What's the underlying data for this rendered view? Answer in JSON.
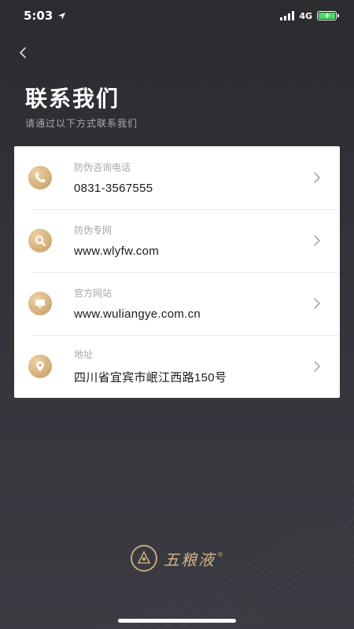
{
  "status_bar": {
    "time": "5:03",
    "network": "4G"
  },
  "header": {
    "title": "联系我们",
    "subtitle": "请通过以下方式联系我们"
  },
  "contacts": [
    {
      "label": "防伪咨询电话",
      "value": "0831-3567555",
      "icon": "phone-icon"
    },
    {
      "label": "防伪专网",
      "value": "www.wlyfw.com",
      "icon": "search-icon"
    },
    {
      "label": "官方网站",
      "value": "www.wuliangye.com.cn",
      "icon": "monitor-icon"
    },
    {
      "label": "地址",
      "value": "四川省宜宾市岷江西路150号",
      "icon": "location-pin-icon"
    }
  ],
  "footer": {
    "brand": "五粮液",
    "registered_mark": "®"
  },
  "colors": {
    "accent_gold": "#d6b07a",
    "background": "#2e2e34",
    "card": "#ffffff"
  }
}
